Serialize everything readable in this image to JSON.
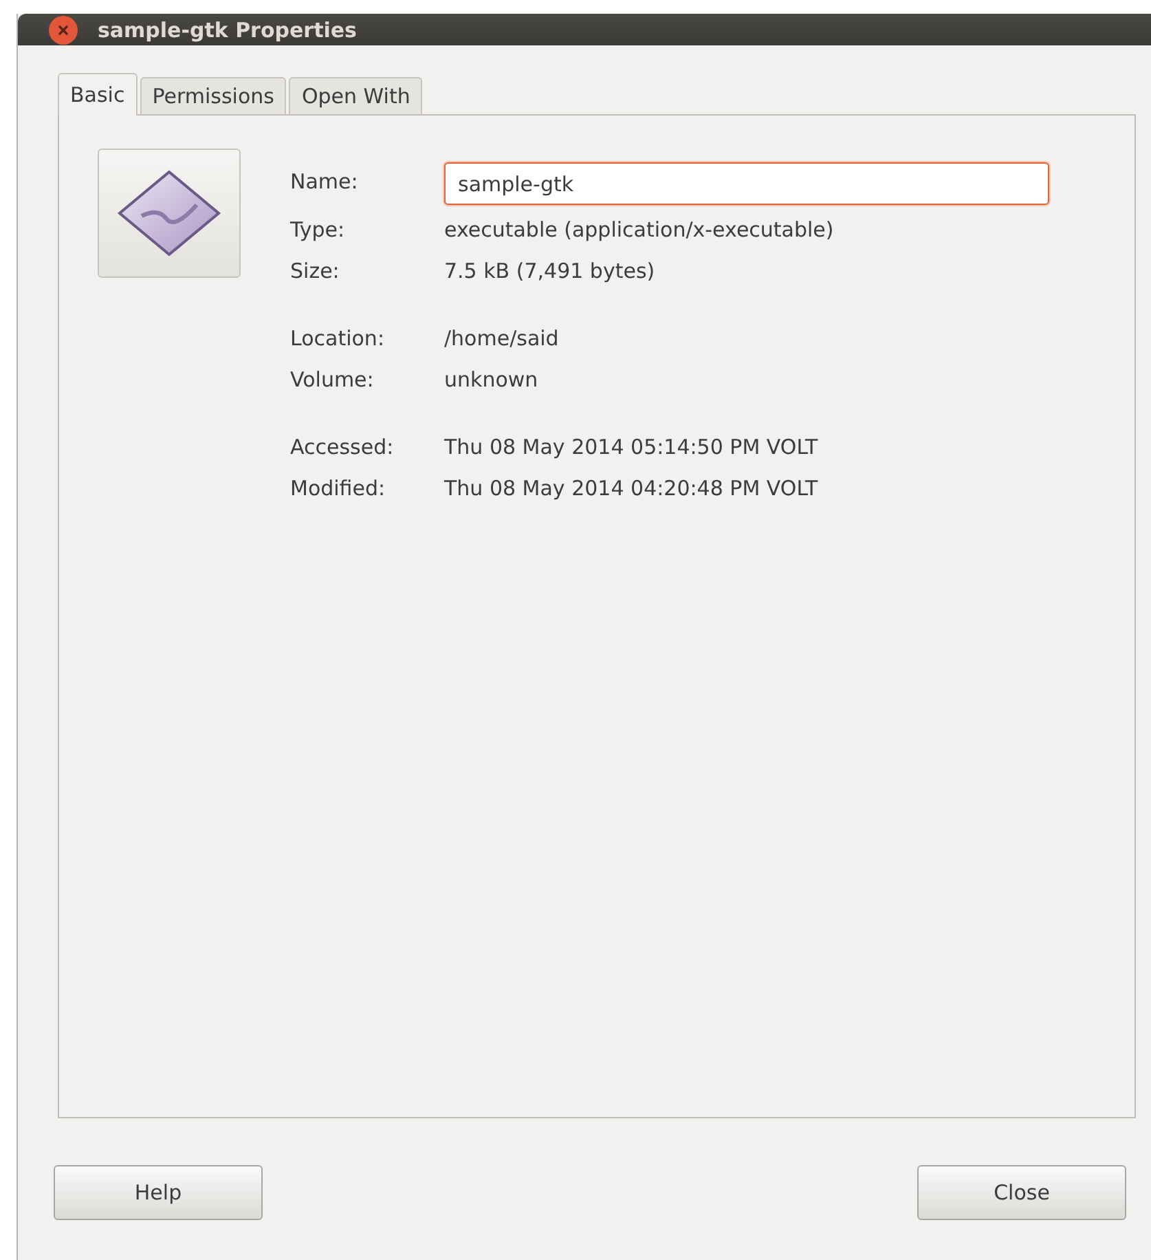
{
  "window": {
    "title": "sample-gtk Properties"
  },
  "tabs": [
    {
      "label": "Basic",
      "selected": true
    },
    {
      "label": "Permissions",
      "selected": false
    },
    {
      "label": "Open With",
      "selected": false
    }
  ],
  "groups": [
    [
      {
        "label": "Name:",
        "kind": "field",
        "value": "sample-gtk"
      },
      {
        "label": "Type:",
        "kind": "text",
        "value": "executable (application/x-executable)"
      },
      {
        "label": "Size:",
        "kind": "text",
        "value": "7.5 kB (7,491 bytes)"
      }
    ],
    [
      {
        "label": "Location:",
        "kind": "text",
        "value": "/home/said"
      },
      {
        "label": "Volume:",
        "kind": "text",
        "value": "unknown"
      }
    ],
    [
      {
        "label": "Accessed:",
        "kind": "text",
        "value": "Thu 08 May 2014 05:14:50 PM VOLT"
      },
      {
        "label": "Modified:",
        "kind": "text",
        "value": "Thu 08 May 2014 04:20:48 PM VOLT"
      }
    ]
  ],
  "buttons": [
    "Help",
    "Close"
  ]
}
